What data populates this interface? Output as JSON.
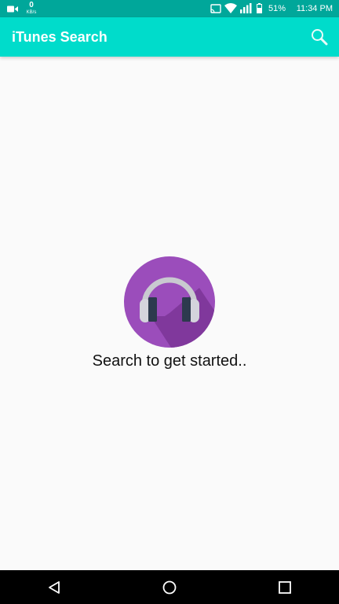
{
  "status_bar": {
    "net_speed_value": "0",
    "net_speed_unit": "KB/s",
    "battery": "51%",
    "time": "11:34 PM",
    "icons": [
      "video-camera-icon",
      "cast-icon",
      "wifi-icon",
      "signal-icon",
      "battery-icon"
    ]
  },
  "app_bar": {
    "title": "iTunes Search",
    "actions": [
      "search-icon"
    ]
  },
  "main": {
    "empty_state_icon": "headphones-icon",
    "empty_state_text": "Search to get started.."
  },
  "nav_bar": {
    "buttons": [
      "back-icon",
      "home-icon",
      "recents-icon"
    ]
  },
  "colors": {
    "status_bar": "#00a79a",
    "app_bar": "#00dccb",
    "background": "#fafafa",
    "headphones_circle": "#9b4dbb"
  }
}
